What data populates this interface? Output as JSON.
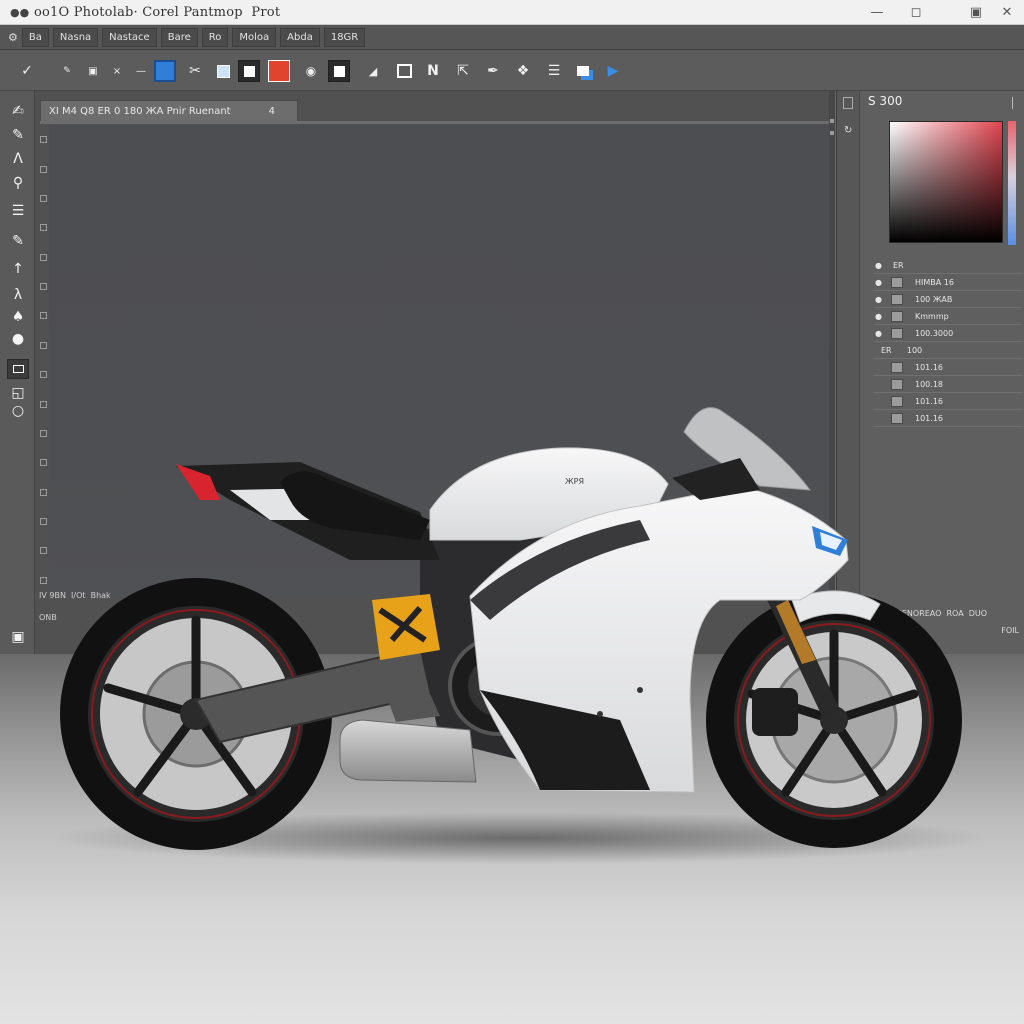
{
  "window": {
    "title": "oo1O Photolab· Corel Pantmop  Prot",
    "app_icon": "app-logo-icon",
    "controls": [
      "minimize-icon",
      "maximize-icon",
      "restore-icon",
      "close-icon"
    ]
  },
  "menu": {
    "items": [
      "Ba",
      "Nasna",
      "Nastace",
      "Bare",
      "Ro",
      "Moloa",
      "Abda",
      "18GR"
    ]
  },
  "toolbar": {
    "tools": [
      "wrench-icon",
      "brush-icon",
      "zoom-icon",
      "close-small-icon",
      "layer-icon",
      "cut-icon",
      "select-icon",
      "fill-icon",
      "red-swatch-icon",
      "view-icon",
      "mask-icon",
      "crop-icon",
      "frame-icon",
      "node-icon",
      "transform-icon",
      "pen-icon",
      "lasso-icon",
      "list-icon",
      "copy-icon",
      "export-icon"
    ]
  },
  "document": {
    "tab_label": "XI M4 Q8  ER 0  180 ЖА  Pnir Ruenant",
    "tab_close": "4",
    "status_line": "IV 9BN  I/Ot  Bhak",
    "status_line2": "ONB"
  },
  "panel": {
    "title": "S 300",
    "layers": [
      {
        "name": "ER"
      },
      {
        "name": "HIMBA 16"
      },
      {
        "name": "100 ЖАВ"
      },
      {
        "name": "Kmmmp"
      },
      {
        "name": "100.3000"
      },
      {
        "name": "ER      100"
      },
      {
        "name": "101.16"
      },
      {
        "name": "100.18"
      },
      {
        "name": "101.16"
      },
      {
        "name": "101.16"
      }
    ],
    "footer": "PENOREAO  ROA  DUO",
    "footer2": "FOIL"
  },
  "colors": {
    "accent": "#2f7fd9",
    "chrome_dark": "#515151",
    "chrome_mid": "#5f5f5f",
    "titlebar": "#f1f1f1",
    "motorcycle_body": "#e9eaeb",
    "tail_light": "#d8242f"
  },
  "scene": {
    "subject": "white sport motorcycle",
    "tank_badge": "ЖРЯ"
  }
}
